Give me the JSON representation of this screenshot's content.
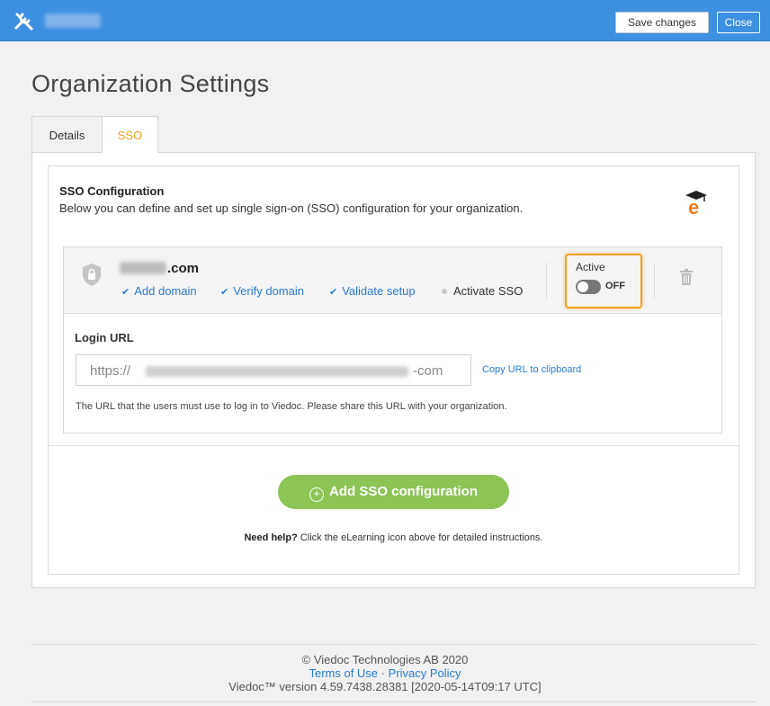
{
  "topbar": {
    "tools_icon": "tools-icon",
    "save_label": "Save changes",
    "close_label": "Close"
  },
  "page": {
    "title": "Organization Settings"
  },
  "tabs": [
    {
      "label": "Details",
      "active": false
    },
    {
      "label": "SSO",
      "active": true
    }
  ],
  "sso": {
    "heading": "SSO Configuration",
    "description": "Below you can define and set up single sign-on (SSO) configuration for your organization.",
    "elearning_icon": "elearning-icon",
    "config": {
      "domain_suffix": ".com",
      "steps": [
        {
          "label": "Add domain",
          "done": true
        },
        {
          "label": "Verify domain",
          "done": true
        },
        {
          "label": "Validate setup",
          "done": true
        },
        {
          "label": "Activate SSO",
          "done": false
        }
      ],
      "active_label": "Active",
      "toggle_state": "OFF",
      "delete_icon": "trash-icon",
      "login_url_label": "Login URL",
      "url_prefix": "https://",
      "url_suffix": "-com",
      "copy_label": "Copy URL to clipboard",
      "url_note": "The URL that the users must use to log in to Viedoc. Please share this URL with your organization."
    },
    "add_button": "Add SSO configuration",
    "help_bold": "Need help?",
    "help_text": " Click the eLearning icon above for detailed instructions."
  },
  "footer": {
    "copyright": "© Viedoc Technologies AB 2020",
    "terms": "Terms of Use",
    "separator": " · ",
    "privacy": "Privacy Policy",
    "version": "Viedoc™ version 4.59.7438.28381 [2020-05-14T09:17 UTC]"
  },
  "colors": {
    "topbar": "#3d8fe0",
    "accent_orange": "#f0a020",
    "link_blue": "#2a7bd4",
    "add_green": "#8cc456"
  }
}
